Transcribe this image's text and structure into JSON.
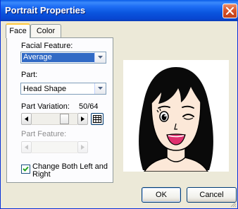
{
  "window": {
    "title": "Portrait Properties",
    "close_icon": "close-x-icon"
  },
  "tabs": [
    {
      "label": "Face",
      "active": true
    },
    {
      "label": "Color",
      "active": false
    }
  ],
  "facial_feature": {
    "label": "Facial Feature:",
    "value": "Average"
  },
  "part": {
    "label": "Part:",
    "value": "Head Shape"
  },
  "part_variation": {
    "label": "Part Variation:",
    "value_text": "50/64",
    "current": 50,
    "max": 64
  },
  "part_feature": {
    "label": "Part Feature:",
    "enabled": false
  },
  "change_both": {
    "label_line1": "Change Both Left and",
    "label_line2": "Right",
    "checked": true
  },
  "buttons": {
    "ok": "OK",
    "cancel": "Cancel"
  },
  "colors": {
    "titlebar": "#0A55DE",
    "dialog_bg": "#ECE9D8",
    "selection": "#316AC5",
    "close_button": "#D9542A",
    "skin": "#FCE8D8",
    "hair": "#0A0A0A",
    "mouth": "#E0306E"
  }
}
